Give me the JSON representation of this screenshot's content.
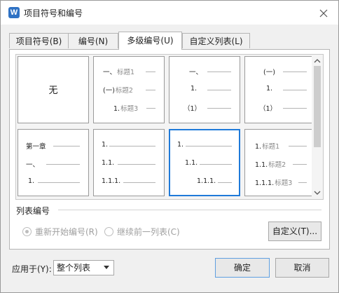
{
  "window": {
    "title": "项目符号和编号"
  },
  "tabs": [
    {
      "label": "项目符号(B)",
      "active": false
    },
    {
      "label": "编号(N)",
      "active": false
    },
    {
      "label": "多级编号(U)",
      "active": true
    },
    {
      "label": "自定义列表(L)",
      "active": false
    }
  ],
  "gallery": {
    "selected_index": 6,
    "items": [
      {
        "none_label": "无"
      },
      {
        "levels": [
          {
            "num": "一、",
            "title": "标题1"
          },
          {
            "num": "(一)",
            "title": "标题2"
          },
          {
            "num": "1.",
            "title": "标题3"
          }
        ]
      },
      {
        "levels": [
          {
            "num": "一、"
          },
          {
            "num": "1."
          },
          {
            "num": "（1）"
          }
        ]
      },
      {
        "levels": [
          {
            "num": "(一)"
          },
          {
            "num": "1."
          },
          {
            "num": "（1）"
          }
        ]
      },
      {
        "levels": [
          {
            "num": "第一章"
          },
          {
            "num": "一、"
          },
          {
            "num": "1."
          }
        ]
      },
      {
        "levels": [
          {
            "num": "1."
          },
          {
            "num": "1.1."
          },
          {
            "num": "1.1.1."
          }
        ]
      },
      {
        "levels": [
          {
            "num": "1."
          },
          {
            "num": "1.1."
          },
          {
            "num": "1.1.1."
          }
        ]
      },
      {
        "levels": [
          {
            "num": "1.",
            "title": "标题1"
          },
          {
            "num": "1.1.",
            "title": "标题2"
          },
          {
            "num": "1.1.1.",
            "title": "标题3"
          }
        ]
      }
    ]
  },
  "list_numbering": {
    "section_label": "列表编号",
    "restart_label": "重新开始编号(R)",
    "continue_label": "继续前一列表(C)",
    "selected": "restart",
    "customize_label": "自定义(T)..."
  },
  "footer": {
    "apply_label": "应用于(Y):",
    "apply_value": "整个列表",
    "ok_label": "确定",
    "cancel_label": "取消"
  },
  "colors": {
    "selection_border": "#1f7ad9",
    "app_icon": "#2f72c4"
  }
}
